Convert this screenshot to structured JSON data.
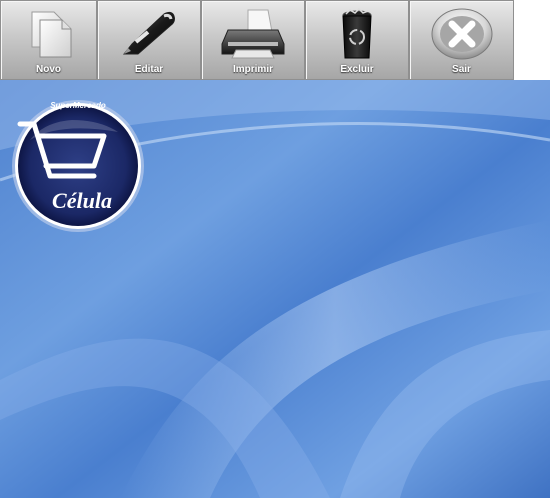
{
  "toolbar": {
    "buttons": [
      {
        "label": "Novo",
        "icon": "new-document-icon"
      },
      {
        "label": "Editar",
        "icon": "pen-icon"
      },
      {
        "label": "Imprimir",
        "icon": "printer-icon"
      },
      {
        "label": "Excluir",
        "icon": "recycle-bin-icon"
      },
      {
        "label": "Sair",
        "icon": "close-icon"
      }
    ]
  },
  "logo": {
    "line1": "SuperMercado",
    "line2": "Célula"
  },
  "colors": {
    "background_blue": "#5b8ed6",
    "logo_navy": "#1c2a66"
  }
}
